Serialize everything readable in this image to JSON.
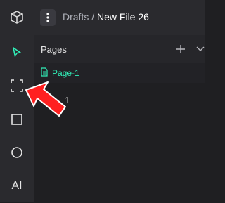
{
  "breadcrumb": {
    "project": "Drafts",
    "separator": "/",
    "file": "New File 26"
  },
  "pages": {
    "title": "Pages",
    "items": [
      {
        "label": "Page-1",
        "active": true
      }
    ]
  },
  "layers_fragment": "1",
  "tools": [
    {
      "name": "move-tool",
      "icon": "pointer-icon",
      "active": true
    },
    {
      "name": "board-tool",
      "icon": "frame-icon"
    },
    {
      "name": "rectangle-tool",
      "icon": "square-icon"
    },
    {
      "name": "ellipse-tool",
      "icon": "circle-icon"
    },
    {
      "name": "text-tool",
      "icon": "text-icon",
      "label": "AI"
    }
  ],
  "colors": {
    "accent": "#31efb8",
    "arrow": "#ff2020",
    "background": "#1f1f22",
    "panel": "#2a2a2e"
  }
}
